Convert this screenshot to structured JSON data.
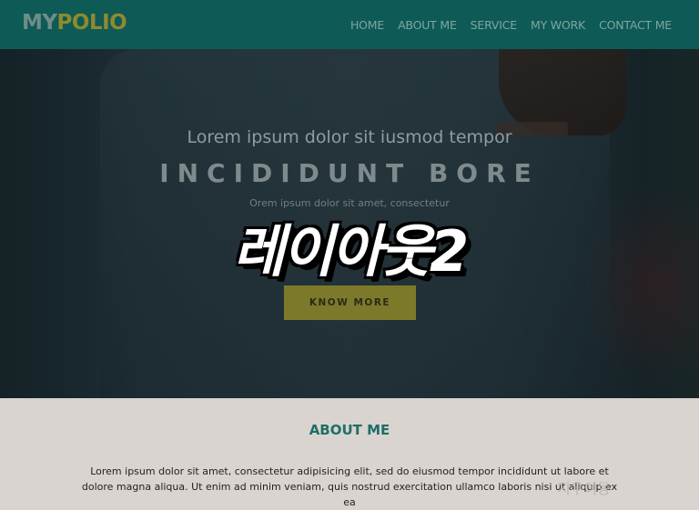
{
  "header": {
    "logo_part1": "MY",
    "logo_part2": "POLIO",
    "nav": [
      "HOME",
      "ABOUT ME",
      "SERVICE",
      "MY WORK",
      "CONTACT ME"
    ]
  },
  "hero": {
    "subtitle": "Lorem ipsum dolor sit iusmod tempor",
    "title": "INCIDIDUNT BORE",
    "small_text": "Orem ipsum dolor sit amet, consectetur",
    "overlay_text": "레이아웃2",
    "button_label": "KNOW MORE"
  },
  "about": {
    "heading": "ABOUT ME",
    "body": "Lorem ipsum dolor sit amet, consectetur adipisicing elit, sed do eiusmod tempor incididunt ut labore et dolore magna aliqua. Ut enim ad minim veniam, quis nostrud exercitation ullamco laboris nisi ut aliquip ex ea",
    "watermark": "지우이동"
  },
  "colors": {
    "header_bg": "#0e5a56",
    "logo_accent": "#8f8a2e",
    "button_bg": "#7c7a2a",
    "about_heading": "#1f6e67"
  }
}
